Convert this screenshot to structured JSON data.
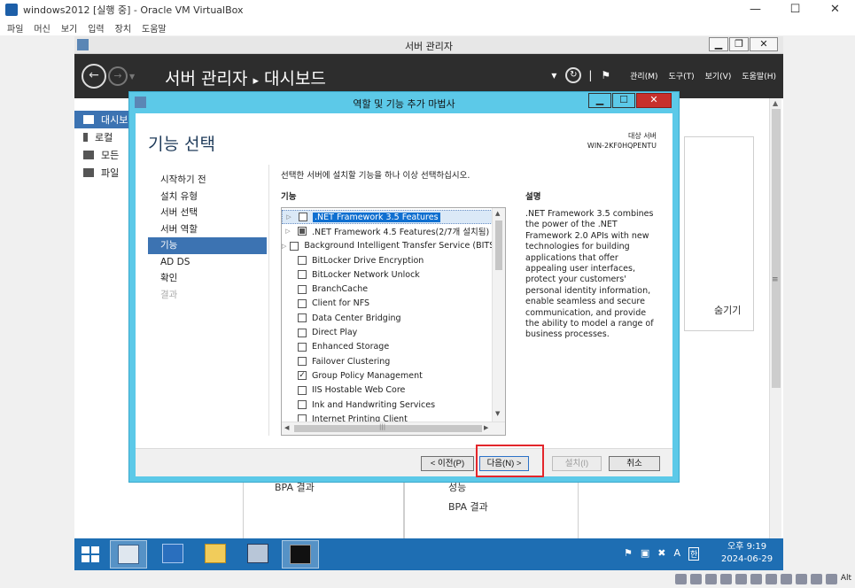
{
  "host": {
    "title": "windows2012 [실행 중] - Oracle VM VirtualBox",
    "menu": [
      "파일",
      "머신",
      "보기",
      "입력",
      "장치",
      "도움말"
    ],
    "window_controls": [
      "—",
      "☐",
      "✕"
    ],
    "status_text": "Alt"
  },
  "server_manager": {
    "window_title": "서버 관리자",
    "breadcrumb_root": "서버 관리자",
    "breadcrumb_sep": "▸",
    "breadcrumb_page": "대시보드",
    "header_menu": [
      "관리(M)",
      "도구(T)",
      "보기(V)",
      "도움말(H)"
    ],
    "sidebar": [
      {
        "label": "대시보"
      },
      {
        "label": "로컬 "
      },
      {
        "label": "모든 "
      },
      {
        "label": "파일 "
      }
    ],
    "bg_hide": "숨기기",
    "bg_bpa_1": "BPA 결과",
    "bg_perf": "성능",
    "bg_bpa_2": "BPA 결과"
  },
  "wizard": {
    "title": "역할 및 기능 추가 마법사",
    "heading": "기능 선택",
    "target_label": "대상 서버",
    "target_server": "WIN-2KF0HQPENTU",
    "nav": [
      {
        "label": "시작하기 전",
        "state": "normal"
      },
      {
        "label": "설치 유형",
        "state": "normal"
      },
      {
        "label": "서버 선택",
        "state": "normal"
      },
      {
        "label": "서버 역할",
        "state": "normal"
      },
      {
        "label": "기능",
        "state": "active"
      },
      {
        "label": "AD DS",
        "state": "normal"
      },
      {
        "label": "확인",
        "state": "normal"
      },
      {
        "label": "결과",
        "state": "disabled"
      }
    ],
    "instruction": "선택한 서버에 설치할 기능을 하나 이상 선택하십시오.",
    "features_label": "기능",
    "description_label": "설명",
    "description": ".NET Framework 3.5 combines the power of the .NET Framework 2.0 APIs with new technologies for building applications that offer appealing user interfaces, protect your customers' personal identity information, enable seamless and secure communication, and provide the ability to model a range of business processes.",
    "features": [
      {
        "label": ".NET Framework 3.5 Features",
        "expandable": true,
        "state": "unchecked",
        "selected": true
      },
      {
        "label": ".NET Framework 4.5 Features(2/7개 설치됨)",
        "expandable": true,
        "state": "partial",
        "selected": false
      },
      {
        "label": "Background Intelligent Transfer Service (BITS)",
        "expandable": true,
        "state": "unchecked",
        "selected": false
      },
      {
        "label": "BitLocker Drive Encryption",
        "expandable": false,
        "state": "unchecked",
        "selected": false
      },
      {
        "label": "BitLocker Network Unlock",
        "expandable": false,
        "state": "unchecked",
        "selected": false
      },
      {
        "label": "BranchCache",
        "expandable": false,
        "state": "unchecked",
        "selected": false
      },
      {
        "label": "Client for NFS",
        "expandable": false,
        "state": "unchecked",
        "selected": false
      },
      {
        "label": "Data Center Bridging",
        "expandable": false,
        "state": "unchecked",
        "selected": false
      },
      {
        "label": "Direct Play",
        "expandable": false,
        "state": "unchecked",
        "selected": false
      },
      {
        "label": "Enhanced Storage",
        "expandable": false,
        "state": "unchecked",
        "selected": false
      },
      {
        "label": "Failover Clustering",
        "expandable": false,
        "state": "unchecked",
        "selected": false
      },
      {
        "label": "Group Policy Management",
        "expandable": false,
        "state": "checked",
        "selected": false
      },
      {
        "label": "IIS Hostable Web Core",
        "expandable": false,
        "state": "unchecked",
        "selected": false
      },
      {
        "label": "Ink and Handwriting Services",
        "expandable": false,
        "state": "unchecked",
        "selected": false
      },
      {
        "label": "Internet Printing Client",
        "expandable": false,
        "state": "unchecked",
        "selected": false
      }
    ],
    "buttons": {
      "prev": "< 이전(P)",
      "next": "다음(N) >",
      "install": "설치(I)",
      "cancel": "취소"
    }
  },
  "taskbar": {
    "time": "오후 9:19",
    "date": "2024-06-29",
    "ime_a": "A",
    "ime_han": "한"
  }
}
